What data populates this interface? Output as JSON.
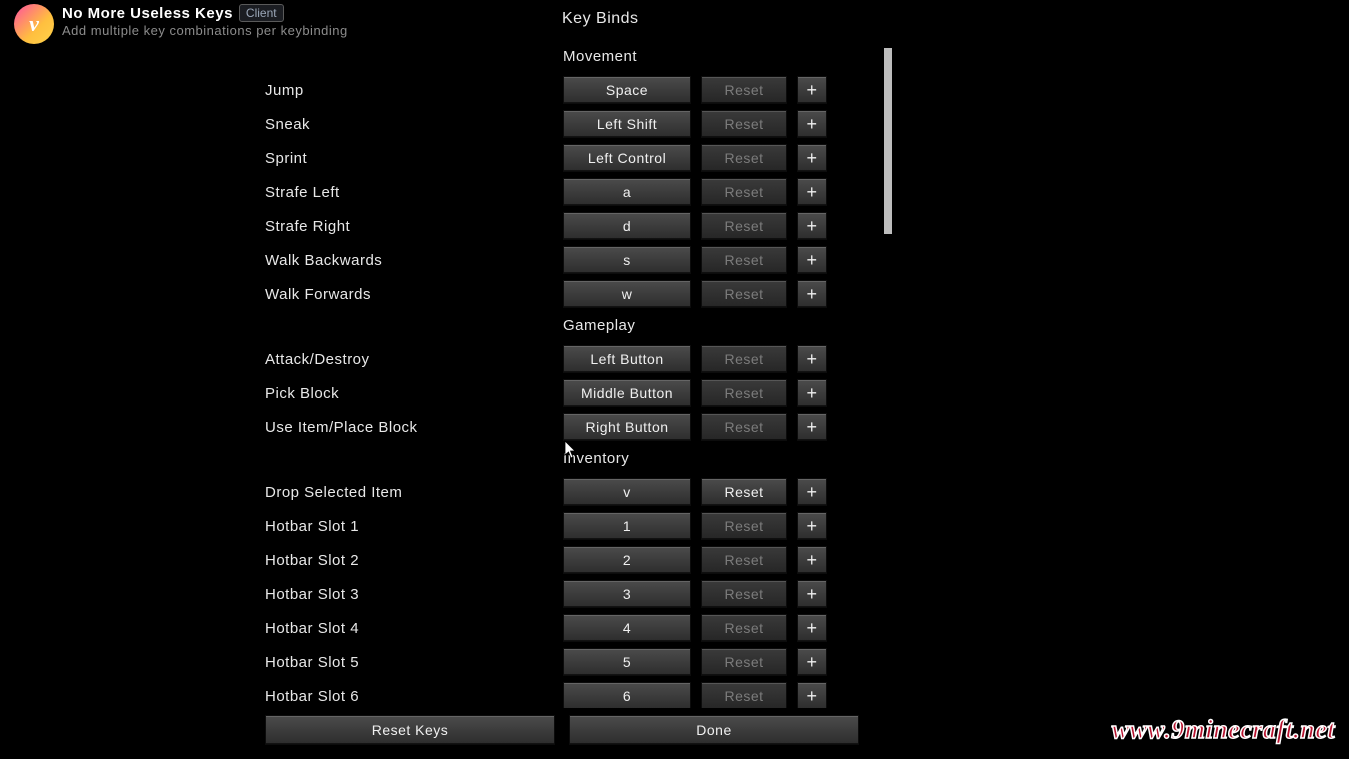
{
  "mod": {
    "icon_letter": "v",
    "name": "No More Useless Keys",
    "badge": "Client",
    "subtitle": "Add multiple key combinations per keybinding"
  },
  "page_title": "Key Binds",
  "sections": [
    {
      "title": "Movement",
      "rows": [
        {
          "label": "Jump",
          "key": "Space",
          "reset": "Reset",
          "reset_enabled": false,
          "plus": "+"
        },
        {
          "label": "Sneak",
          "key": "Left Shift",
          "reset": "Reset",
          "reset_enabled": false,
          "plus": "+"
        },
        {
          "label": "Sprint",
          "key": "Left Control",
          "reset": "Reset",
          "reset_enabled": false,
          "plus": "+"
        },
        {
          "label": "Strafe Left",
          "key": "a",
          "reset": "Reset",
          "reset_enabled": false,
          "plus": "+"
        },
        {
          "label": "Strafe Right",
          "key": "d",
          "reset": "Reset",
          "reset_enabled": false,
          "plus": "+"
        },
        {
          "label": "Walk Backwards",
          "key": "s",
          "reset": "Reset",
          "reset_enabled": false,
          "plus": "+"
        },
        {
          "label": "Walk Forwards",
          "key": "w",
          "reset": "Reset",
          "reset_enabled": false,
          "plus": "+"
        }
      ]
    },
    {
      "title": "Gameplay",
      "rows": [
        {
          "label": "Attack/Destroy",
          "key": "Left Button",
          "reset": "Reset",
          "reset_enabled": false,
          "plus": "+"
        },
        {
          "label": "Pick Block",
          "key": "Middle Button",
          "reset": "Reset",
          "reset_enabled": false,
          "plus": "+"
        },
        {
          "label": "Use Item/Place Block",
          "key": "Right Button",
          "reset": "Reset",
          "reset_enabled": false,
          "plus": "+"
        }
      ]
    },
    {
      "title": "Inventory",
      "rows": [
        {
          "label": "Drop Selected Item",
          "key": "v",
          "reset": "Reset",
          "reset_enabled": true,
          "plus": "+"
        },
        {
          "label": "Hotbar Slot 1",
          "key": "1",
          "reset": "Reset",
          "reset_enabled": false,
          "plus": "+"
        },
        {
          "label": "Hotbar Slot 2",
          "key": "2",
          "reset": "Reset",
          "reset_enabled": false,
          "plus": "+"
        },
        {
          "label": "Hotbar Slot 3",
          "key": "3",
          "reset": "Reset",
          "reset_enabled": false,
          "plus": "+"
        },
        {
          "label": "Hotbar Slot 4",
          "key": "4",
          "reset": "Reset",
          "reset_enabled": false,
          "plus": "+"
        },
        {
          "label": "Hotbar Slot 5",
          "key": "5",
          "reset": "Reset",
          "reset_enabled": false,
          "plus": "+"
        },
        {
          "label": "Hotbar Slot 6",
          "key": "6",
          "reset": "Reset",
          "reset_enabled": false,
          "plus": "+"
        }
      ]
    }
  ],
  "bottom": {
    "reset_keys": "Reset Keys",
    "done": "Done"
  },
  "watermark": "www.9minecraft.net"
}
